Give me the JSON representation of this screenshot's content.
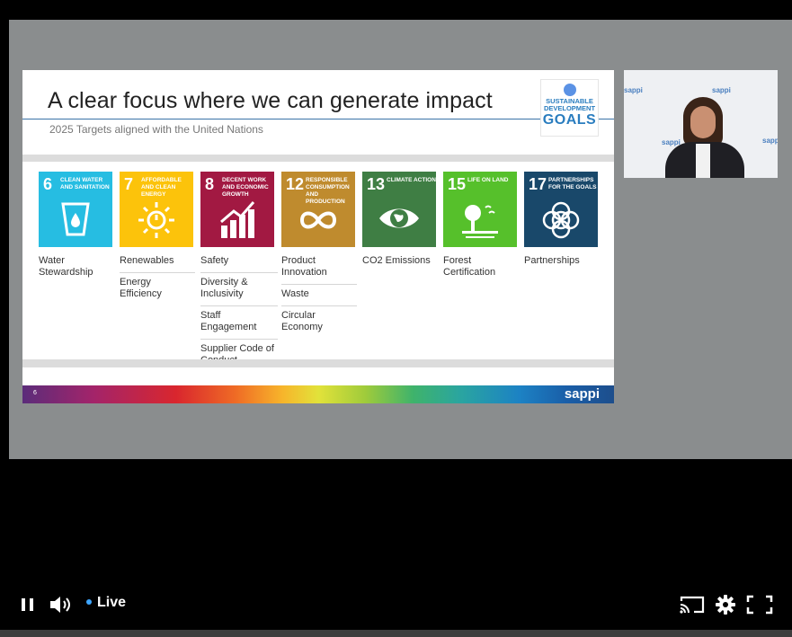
{
  "slide": {
    "title": "A clear focus where we can generate impact",
    "subtitle": "2025 Targets aligned with the United Nations",
    "sdg_logo": {
      "line1": "SUSTAINABLE",
      "line2": "DEVELOPMENT",
      "line3": "GOALS"
    },
    "page_number": "6",
    "brand": "sappi",
    "goals": [
      {
        "number": "6",
        "title": "Clean water and sanitation",
        "color": "#26bde2",
        "items": [
          "Water Stewardship"
        ]
      },
      {
        "number": "7",
        "title": "Affordable and clean energy",
        "color": "#fcc30b",
        "items": [
          "Renewables",
          "Energy Efficiency"
        ]
      },
      {
        "number": "8",
        "title": "Decent work and economic growth",
        "color": "#a21942",
        "items": [
          "Safety",
          "Diversity & Inclusivity",
          "Staff Engagement",
          "Supplier Code of Conduct"
        ]
      },
      {
        "number": "12",
        "title": "Responsible consumption and production",
        "color": "#bf8b2e",
        "items": [
          "Product Innovation",
          "Waste",
          "Circular Economy"
        ]
      },
      {
        "number": "13",
        "title": "Climate action",
        "color": "#3f7e44",
        "items": [
          "CO2 Emissions"
        ]
      },
      {
        "number": "15",
        "title": "Life on land",
        "color": "#56c02b",
        "items": [
          "Forest Certification"
        ]
      },
      {
        "number": "17",
        "title": "Partnerships for the goals",
        "color": "#19486a",
        "items": [
          "Partnerships"
        ]
      }
    ]
  },
  "speaker_video": {
    "watermarks": [
      "sappi",
      "sappi",
      "sappi",
      "sappi"
    ]
  },
  "player": {
    "live_label": "Live",
    "icons": [
      "pause-icon",
      "volume-icon",
      "cast-icon",
      "gear-icon",
      "fullscreen-icon"
    ],
    "accent": "#3ea6ff"
  }
}
